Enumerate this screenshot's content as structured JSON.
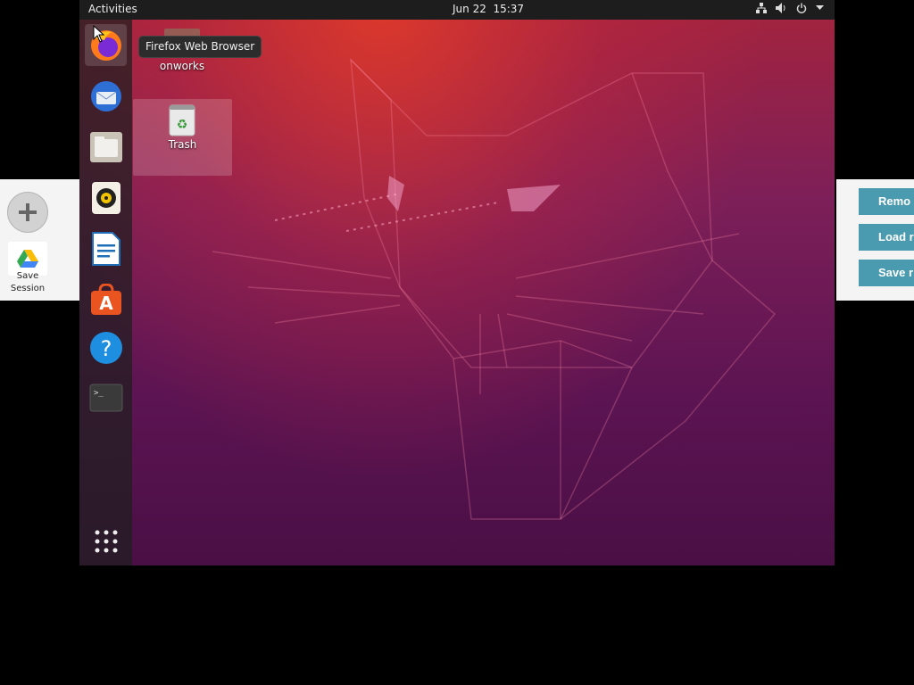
{
  "topbar": {
    "activities": "Activities",
    "date": "Jun 22",
    "time": "15:37"
  },
  "tooltip": "Firefox Web Browser",
  "desktop": {
    "folder_label": "onworks",
    "trash_label": "Trash"
  },
  "dock": [
    {
      "name": "firefox-icon"
    },
    {
      "name": "thunderbird-icon"
    },
    {
      "name": "files-icon"
    },
    {
      "name": "rhythmbox-icon"
    },
    {
      "name": "libreoffice-writer-icon"
    },
    {
      "name": "software-center-icon"
    },
    {
      "name": "help-icon"
    },
    {
      "name": "terminal-icon"
    },
    {
      "name": "show-applications-icon"
    }
  ],
  "left_panel": {
    "save_session_line1": "Save",
    "save_session_line2": "Session"
  },
  "right_panel": {
    "btn1": "Remo",
    "btn2": "Load r",
    "btn3": "Save r"
  },
  "colors": {
    "topbar": "#1d1d1d",
    "panel_button": "#4a9bb0",
    "wallpaper_top": "#a5243d",
    "wallpaper_bottom": "#4a0f45"
  }
}
